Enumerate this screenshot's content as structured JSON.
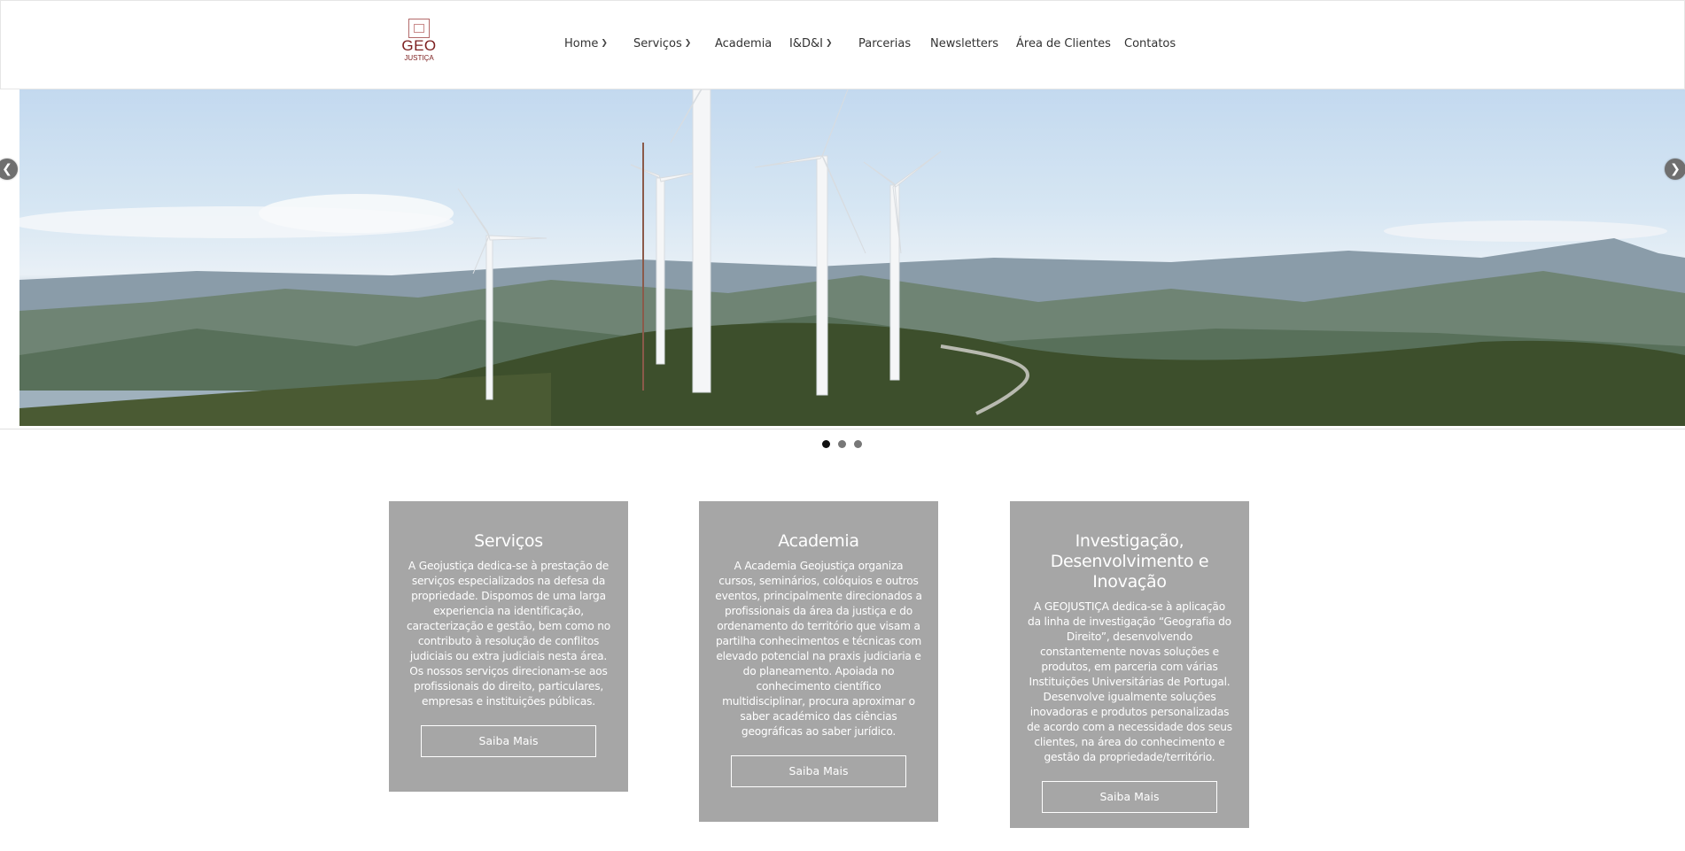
{
  "logo": {
    "text": "GEO",
    "subtext": "JUSTIÇA",
    "tagline": ""
  },
  "nav": {
    "items": [
      {
        "label": "Home",
        "has_dropdown": true
      },
      {
        "label": "Serviços",
        "has_dropdown": true
      },
      {
        "label": "Academia",
        "has_dropdown": false
      },
      {
        "label": "I&D&I",
        "has_dropdown": true
      },
      {
        "label": "Parcerias",
        "has_dropdown": false
      },
      {
        "label": "Newsletters",
        "has_dropdown": false
      },
      {
        "label": "Área de Clientes",
        "has_dropdown": false
      },
      {
        "label": "Contatos",
        "has_dropdown": false
      }
    ]
  },
  "slider": {
    "prev_icon": "chevron-left-icon",
    "next_icon": "chevron-right-icon",
    "dots": 3,
    "active_dot": 0,
    "image_description_icon": "wind-turbines-landscape"
  },
  "cards": [
    {
      "title": "Serviços",
      "text": "A Geojustiça dedica-se à prestação de serviços especializados na defesa da propriedade. Dispomos de uma larga experiencia na identificação, caracterização e gestão, bem como no contributo à resolução de conflitos judiciais ou extra judiciais nesta área. Os nossos serviços direcionam-se aos profissionais do direito, particulares, empresas e instituições públicas.",
      "button": "Saiba Mais"
    },
    {
      "title": "Academia",
      "text": "A Academia Geojustiça organiza cursos, seminários, colóquios e outros eventos, principalmente direcionados a profissionais da área da justiça e do ordenamento do território que visam a partilha conhecimentos e técnicas com elevado potencial na praxis judiciaria e do planeamento. Apoiada no conhecimento científico multidisciplinar, procura aproximar o saber académico das ciências geográficas ao saber jurídico.",
      "button": "Saiba Mais"
    },
    {
      "title": "Investigação, Desenvolvimento e Inovação",
      "text": "A GEOJUSTIÇA dedica-se à aplicação da linha de investigação “Geografia do Direito”, desenvolvendo constantemente novas soluções e produtos, em parceria com várias Instituições Universitárias de Portugal. Desenvolve igualmente soluções inovadoras e produtos personalizadas de acordo com a necessidade dos seus clientes, na área do conhecimento e gestão da propriedade/território.",
      "button": "Saiba Mais"
    }
  ],
  "colors": {
    "card_bg": "#a6a6a6",
    "logo": "#7d2020",
    "nav_text": "#333333",
    "dot_active": "#111111",
    "dot_inactive": "#777777"
  }
}
